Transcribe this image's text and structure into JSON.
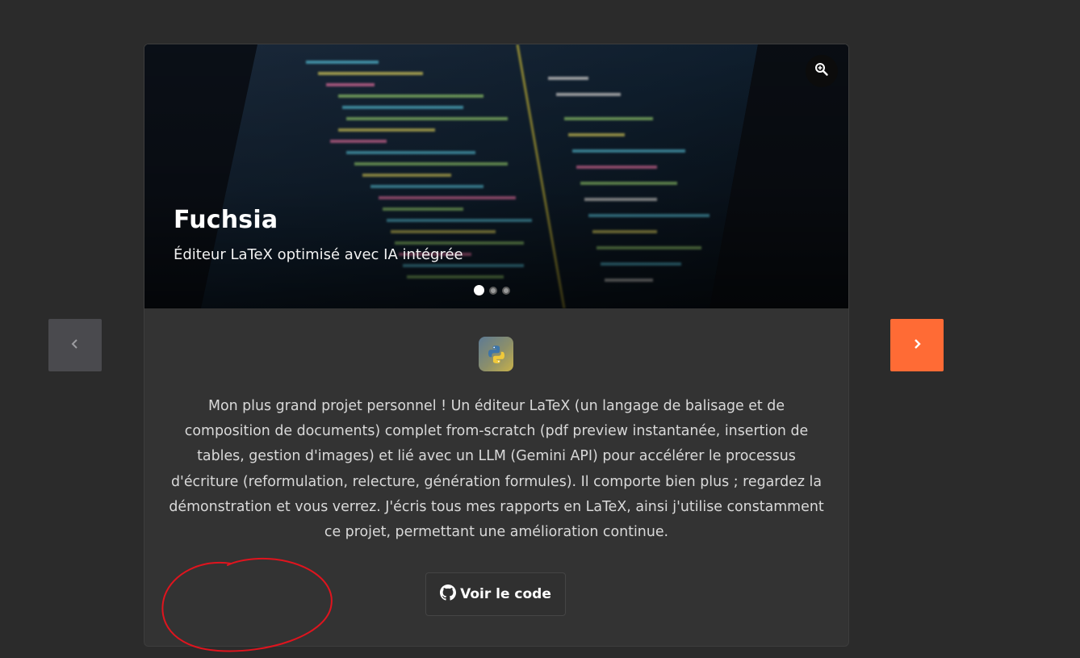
{
  "project": {
    "title": "Fuchsia",
    "subtitle": "Éditeur LaTeX optimisé avec IA intégrée",
    "description": "Mon plus grand projet personnel ! Un éditeur LaTeX (un langage de balisage et de composition de documents) complet from-scratch (pdf preview instantanée, insertion de tables, gestion d'images) et lié avec un LLM (Gemini API) pour accélérer le processus d'écriture (reformulation, relecture, génération formules). Il comporte bien plus ; regardez la démonstration et vous verrez. J'écris tous mes rapports en LaTeX, ainsi j'utilise constamment ce projet, permettant une amélioration continue.",
    "tech_icon": "python-icon",
    "code_button_label": "Voir le code",
    "code_button_icon": "github-icon"
  },
  "carousel": {
    "slide_count": 3,
    "active_slide": 1,
    "prev_icon": "chevron-left-icon",
    "next_icon": "chevron-right-icon",
    "zoom_icon": "zoom-in-icon"
  },
  "colors": {
    "page_background": "#2b2b2b",
    "card_background": "#333333",
    "accent": "#ff6b35",
    "prev_button": "#4a4a4e",
    "annotation": "#e0141e"
  }
}
